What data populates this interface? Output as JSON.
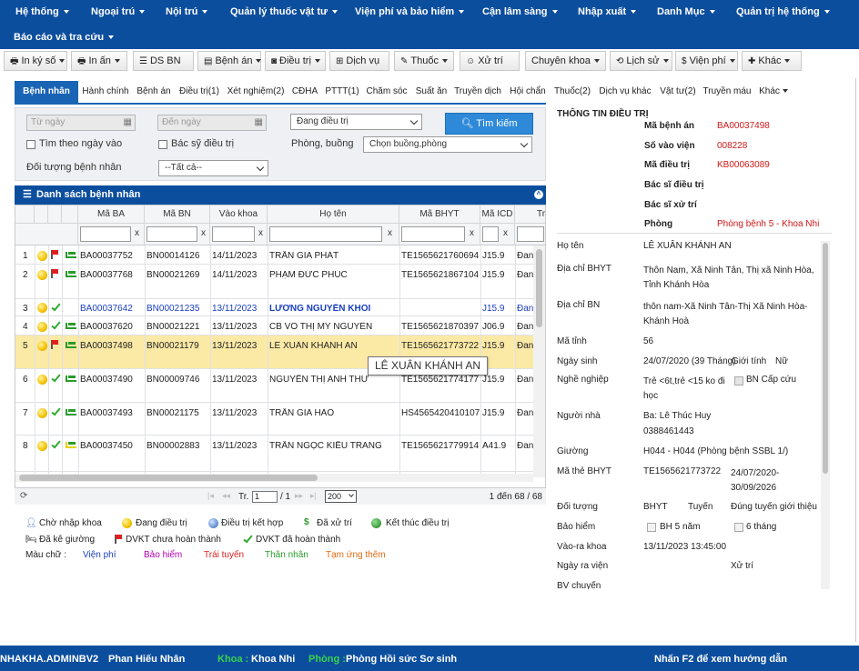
{
  "menu": [
    "Hệ thống",
    "Ngoại trú",
    "Nội trú",
    "Quản lý thuốc vật tư",
    "Viện phí và bảo hiểm",
    "Cận lâm sàng",
    "Nhập xuất",
    "Danh Mục",
    "Quản trị hệ thống",
    "Báo cáo và tra cứu"
  ],
  "toolbar": [
    "In ký số",
    "In ấn",
    "DS BN",
    "Bệnh án",
    "Điều trị",
    "Dịch vụ",
    "Thuốc",
    "Xử trí",
    "Chuyên khoa",
    "Lịch sử",
    "Viện phí",
    "Khác"
  ],
  "tabs": [
    "Bệnh nhân",
    "Hành chính",
    "Bệnh án",
    "Điều trị(1)",
    "Xét nghiệm(2)",
    "CĐHA",
    "PTTT(1)",
    "Chăm sóc",
    "Suất ăn",
    "Truyền dịch",
    "Hội chẩn",
    "Thuốc(2)",
    "Dịch vụ khác",
    "Vật tư(2)",
    "Truyền máu",
    "Khác"
  ],
  "filter": {
    "from_date": "Từ ngày",
    "to_date": "Đến ngày",
    "status": "Đang điều trị",
    "search": "Tìm kiếm",
    "search_by_date": "Tìm theo ngày vào",
    "doctor": "Bác sỹ điều trị",
    "room_label": "Phòng, buồng",
    "room_value": "Chọn buồng,phòng",
    "patient_type_label": "Đối tượng bệnh nhân",
    "patient_type_value": "--Tất cả--"
  },
  "list": {
    "title": "Danh sách bệnh nhân",
    "columns": [
      "Mã BA",
      "Mã BN",
      "Vào khoa",
      "Họ tên",
      "Mã BHYT",
      "Mã ICD",
      "Tra"
    ],
    "rows": [
      {
        "n": "1",
        "ba": "BA00037752",
        "bn": "BN00014126",
        "date": "14/11/2023",
        "name": "TRẦN GIA PHÁT",
        "bhyt": "TE1565621760694",
        "icd": "J15.9",
        "more": "Đan"
      },
      {
        "n": "2",
        "ba": "BA00037768",
        "bn": "BN00021269",
        "date": "14/11/2023",
        "name": "PHẠM ĐỨC PHÚC",
        "bhyt": "TE1565621867104",
        "icd": "J15.9",
        "more": "Đan"
      },
      {
        "n": "3",
        "ba": "BA00037642",
        "bn": "BN00021235",
        "date": "13/11/2023",
        "name": "LƯƠNG NGUYỄN KHÔI",
        "bhyt": "",
        "icd": "J15.9",
        "more": "Đan"
      },
      {
        "n": "4",
        "ba": "BA00037620",
        "bn": "BN00021221",
        "date": "13/11/2023",
        "name": "CB VÕ THỊ MỸ NGUYÊN",
        "bhyt": "TE1565621870397",
        "icd": "J06.9",
        "more": "Đan"
      },
      {
        "n": "5",
        "ba": "BA00037498",
        "bn": "BN00021179",
        "date": "13/11/2023",
        "name": "LÊ XUÂN KHÁNH AN",
        "bhyt": "TE1565621773722",
        "icd": "J15.9",
        "more": "Đan"
      },
      {
        "n": "6",
        "ba": "BA00037490",
        "bn": "BN00009746",
        "date": "13/11/2023",
        "name": "NGUYỄN THỊ ANH THƯ",
        "bhyt": "TE1565621774177",
        "icd": "J15.9",
        "more": "Đan"
      },
      {
        "n": "7",
        "ba": "BA00037493",
        "bn": "BN00021175",
        "date": "13/11/2023",
        "name": "TRẦN GIA HÀO",
        "bhyt": "HS4565420410107",
        "icd": "J15.9",
        "more": "Đan"
      },
      {
        "n": "8",
        "ba": "BA00037450",
        "bn": "BN00002883",
        "date": "13/11/2023",
        "name": "TRẦN NGỌC KIỀU TRANG",
        "bhyt": "TE1565621779914",
        "icd": "A41.9",
        "more": "Đan"
      }
    ],
    "tooltip": "LÊ XUÂN KHÁNH AN",
    "pager": {
      "page": "1",
      "total_pages": "/ 1",
      "page_size": "200",
      "summary": "1 đến 68 / 68",
      "tr": "Tr."
    }
  },
  "legend": [
    "Chờ nhập khoa",
    "Đang điều trị",
    "Điều trị kết hợp",
    "Đã xử trí",
    "Kết thúc điều trị",
    "Đã kê giường",
    "DVKT chưa hoàn thành",
    "DVKT đã hoàn thành"
  ],
  "colors_legend": {
    "label": "Màu chữ :",
    "items": [
      "Viện phí",
      "Bảo hiểm",
      "Trái tuyến",
      "Thân nhân",
      "Tạm ứng thêm"
    ]
  },
  "info": {
    "title": "THÔNG TIN ĐIỀU TRỊ",
    "ma_ba_l": "Mã bệnh án",
    "ma_ba": "BA00037498",
    "svv_l": "Số vào viện",
    "svv": "008228",
    "mdt_l": "Mã điều trị",
    "mdt": "KB00063089",
    "bsdt_l": "Bác sĩ điều trị",
    "bsxt_l": "Bác sĩ xử trí",
    "phong_l": "Phòng",
    "phong": "Phòng bệnh 5 - Khoa Nhi"
  },
  "detail": {
    "hoten_l": "Họ tên",
    "hoten": "LÊ XUÂN KHÁNH AN",
    "dc_bhyt_l": "Địa chỉ BHYT",
    "dc_bhyt": "Thôn Nam, Xã Ninh Tân, Thị xã Ninh Hòa, Tỉnh Khánh Hòa",
    "dc_bn_l": "Địa chỉ BN",
    "dc_bn": "thôn nam-Xã Ninh Tân-Thị Xã Ninh Hòa-Khánh Hoà",
    "matinh_l": "Mã tỉnh",
    "matinh": "56",
    "ngaysinh_l": "Ngày sinh",
    "ngaysinh": "24/07/2020 (39 Tháng)",
    "gioitinh_l": "Giới tính",
    "gioitinh": "Nữ",
    "nghe_l": "Nghề nghiệp",
    "nghe": "Trẻ <6t,trẻ <15 ko đi học",
    "bn_capcuu": "BN Cấp cứu",
    "nguoinha_l": "Người nhà",
    "nguoinha": "Ba: Lê Thúc Huy",
    "sdt": "0388461443",
    "giuong_l": "Giường",
    "giuong": "H044 - H044 (Phòng bệnh SSBL 1/)",
    "bhyt_l": "Mã thẻ BHYT",
    "bhyt": "TE1565621773722",
    "bhyt_han": "24/07/2020-30/09/2026",
    "doituong_l": "Đối tượng",
    "doituong": "BHYT",
    "tuyen": "Tuyến",
    "tuyen_v": "Đúng tuyến giới thiệu",
    "baohiem_l": "Bảo hiểm",
    "bh5": "BH 5 năm",
    "t6": "6 tháng",
    "vaora_l": "Vào-ra khoa",
    "vaora": "13/11/2023 13:45:00",
    "ravien_l": "Ngày ra viện",
    "xutri": "Xử trí",
    "bvchuyen_l": "BV chuyển"
  },
  "status": {
    "user": "NHAKHA.ADMINBV2",
    "name": "Phan Hiếu Nhân",
    "khoa_l": "Khoa :",
    "khoa": "Khoa Nhi",
    "phong_l": "Phòng :",
    "phong": "Phòng Hồi sức Sơ sinh",
    "hint": "Nhấn F2 để xem hướng dẫn"
  }
}
